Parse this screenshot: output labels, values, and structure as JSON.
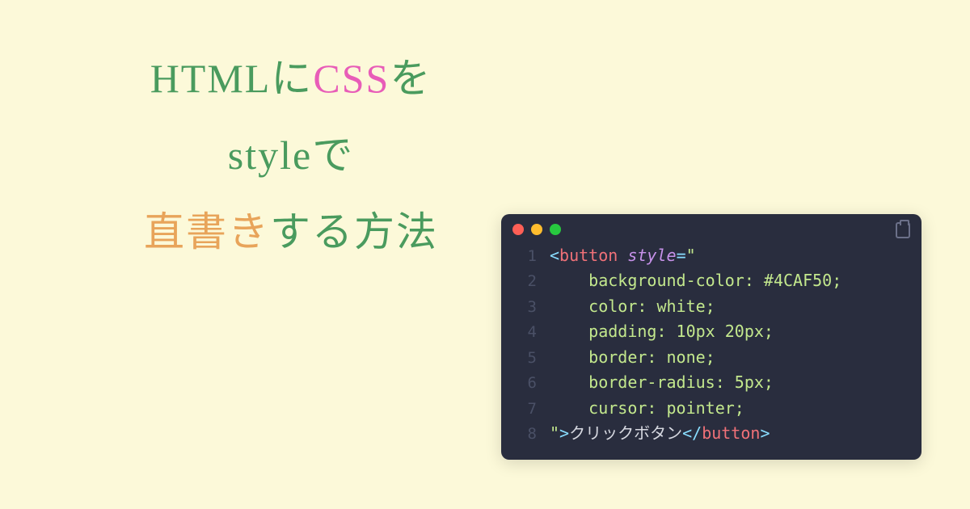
{
  "title": {
    "line1": {
      "part1": "HTML",
      "part2": "に",
      "part3": "CSS",
      "part4": "を"
    },
    "line2": {
      "part1": "style",
      "part2": "で"
    },
    "line3": {
      "part1": "直書き",
      "part2": "する方法"
    }
  },
  "code": {
    "linenums": [
      "1",
      "2",
      "3",
      "4",
      "5",
      "6",
      "7",
      "8"
    ],
    "l1": {
      "lt": "<",
      "tag": "button",
      "sp": " ",
      "attr": "style",
      "eq": "=",
      "q": "\""
    },
    "l2": "    background-color: #4CAF50;",
    "l3": "    color: white;",
    "l4": "    padding: 10px 20px;",
    "l5": "    border: none;",
    "l6": "    border-radius: 5px;",
    "l7": "    cursor: pointer;",
    "l8": {
      "q": "\"",
      "gt": ">",
      "text": "クリックボタン",
      "lts": "</",
      "tag": "button",
      "gt2": ">"
    }
  }
}
